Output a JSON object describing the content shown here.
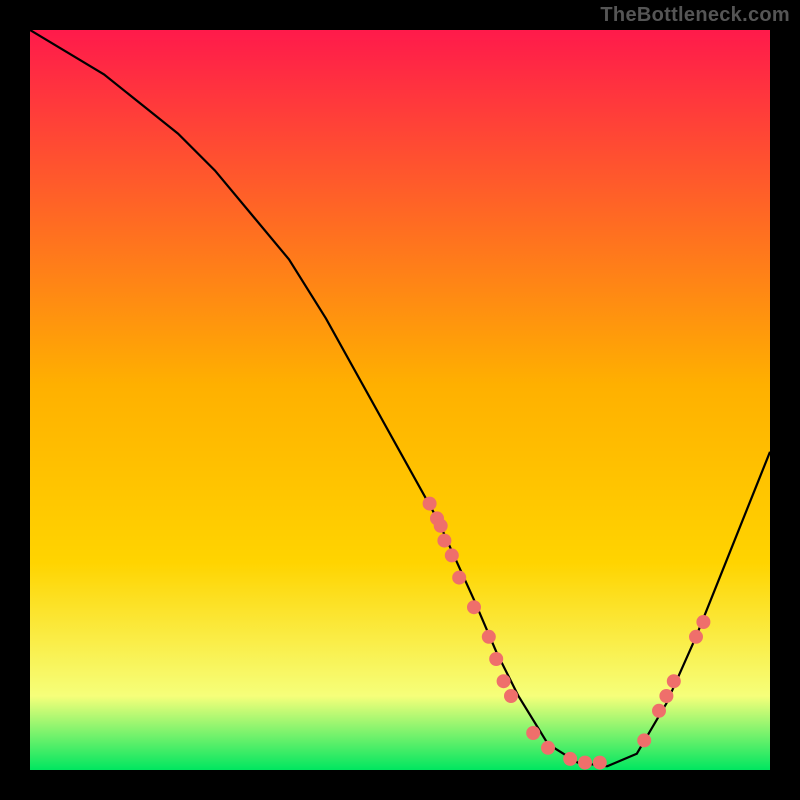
{
  "watermark": "TheBottleneck.com",
  "colors": {
    "frame": "#000000",
    "watermark": "#555555",
    "curve": "#000000",
    "dots": "#ef6f6b",
    "gradient_top": "#ff1a4b",
    "gradient_mid": "#ffd400",
    "gradient_low": "#f6ff7a",
    "gradient_bottom": "#00e660"
  },
  "chart_data": {
    "type": "line",
    "title": "",
    "xlabel": "",
    "ylabel": "",
    "xlim": [
      0,
      100
    ],
    "ylim": [
      0,
      100
    ],
    "x": [
      0,
      5,
      10,
      15,
      20,
      25,
      30,
      35,
      40,
      45,
      50,
      55,
      60,
      63,
      66,
      70,
      74,
      78,
      82,
      86,
      90,
      94,
      98,
      100
    ],
    "values": [
      100,
      97,
      94,
      90,
      86,
      81,
      75,
      69,
      61,
      52,
      43,
      34,
      23,
      16,
      10,
      3.5,
      1.0,
      0.5,
      2.2,
      9,
      18,
      28,
      38,
      43
    ],
    "series": [
      {
        "name": "dots",
        "type": "scatter",
        "x": [
          54,
          55,
          55.5,
          56,
          57,
          58,
          60,
          62,
          63,
          64,
          65,
          68,
          70,
          73,
          75,
          77,
          83,
          85,
          86,
          87,
          90,
          91
        ],
        "y": [
          36,
          34,
          33,
          31,
          29,
          26,
          22,
          18,
          15,
          12,
          10,
          5,
          3,
          1.5,
          1,
          1,
          4,
          8,
          10,
          12,
          18,
          20
        ]
      }
    ]
  }
}
